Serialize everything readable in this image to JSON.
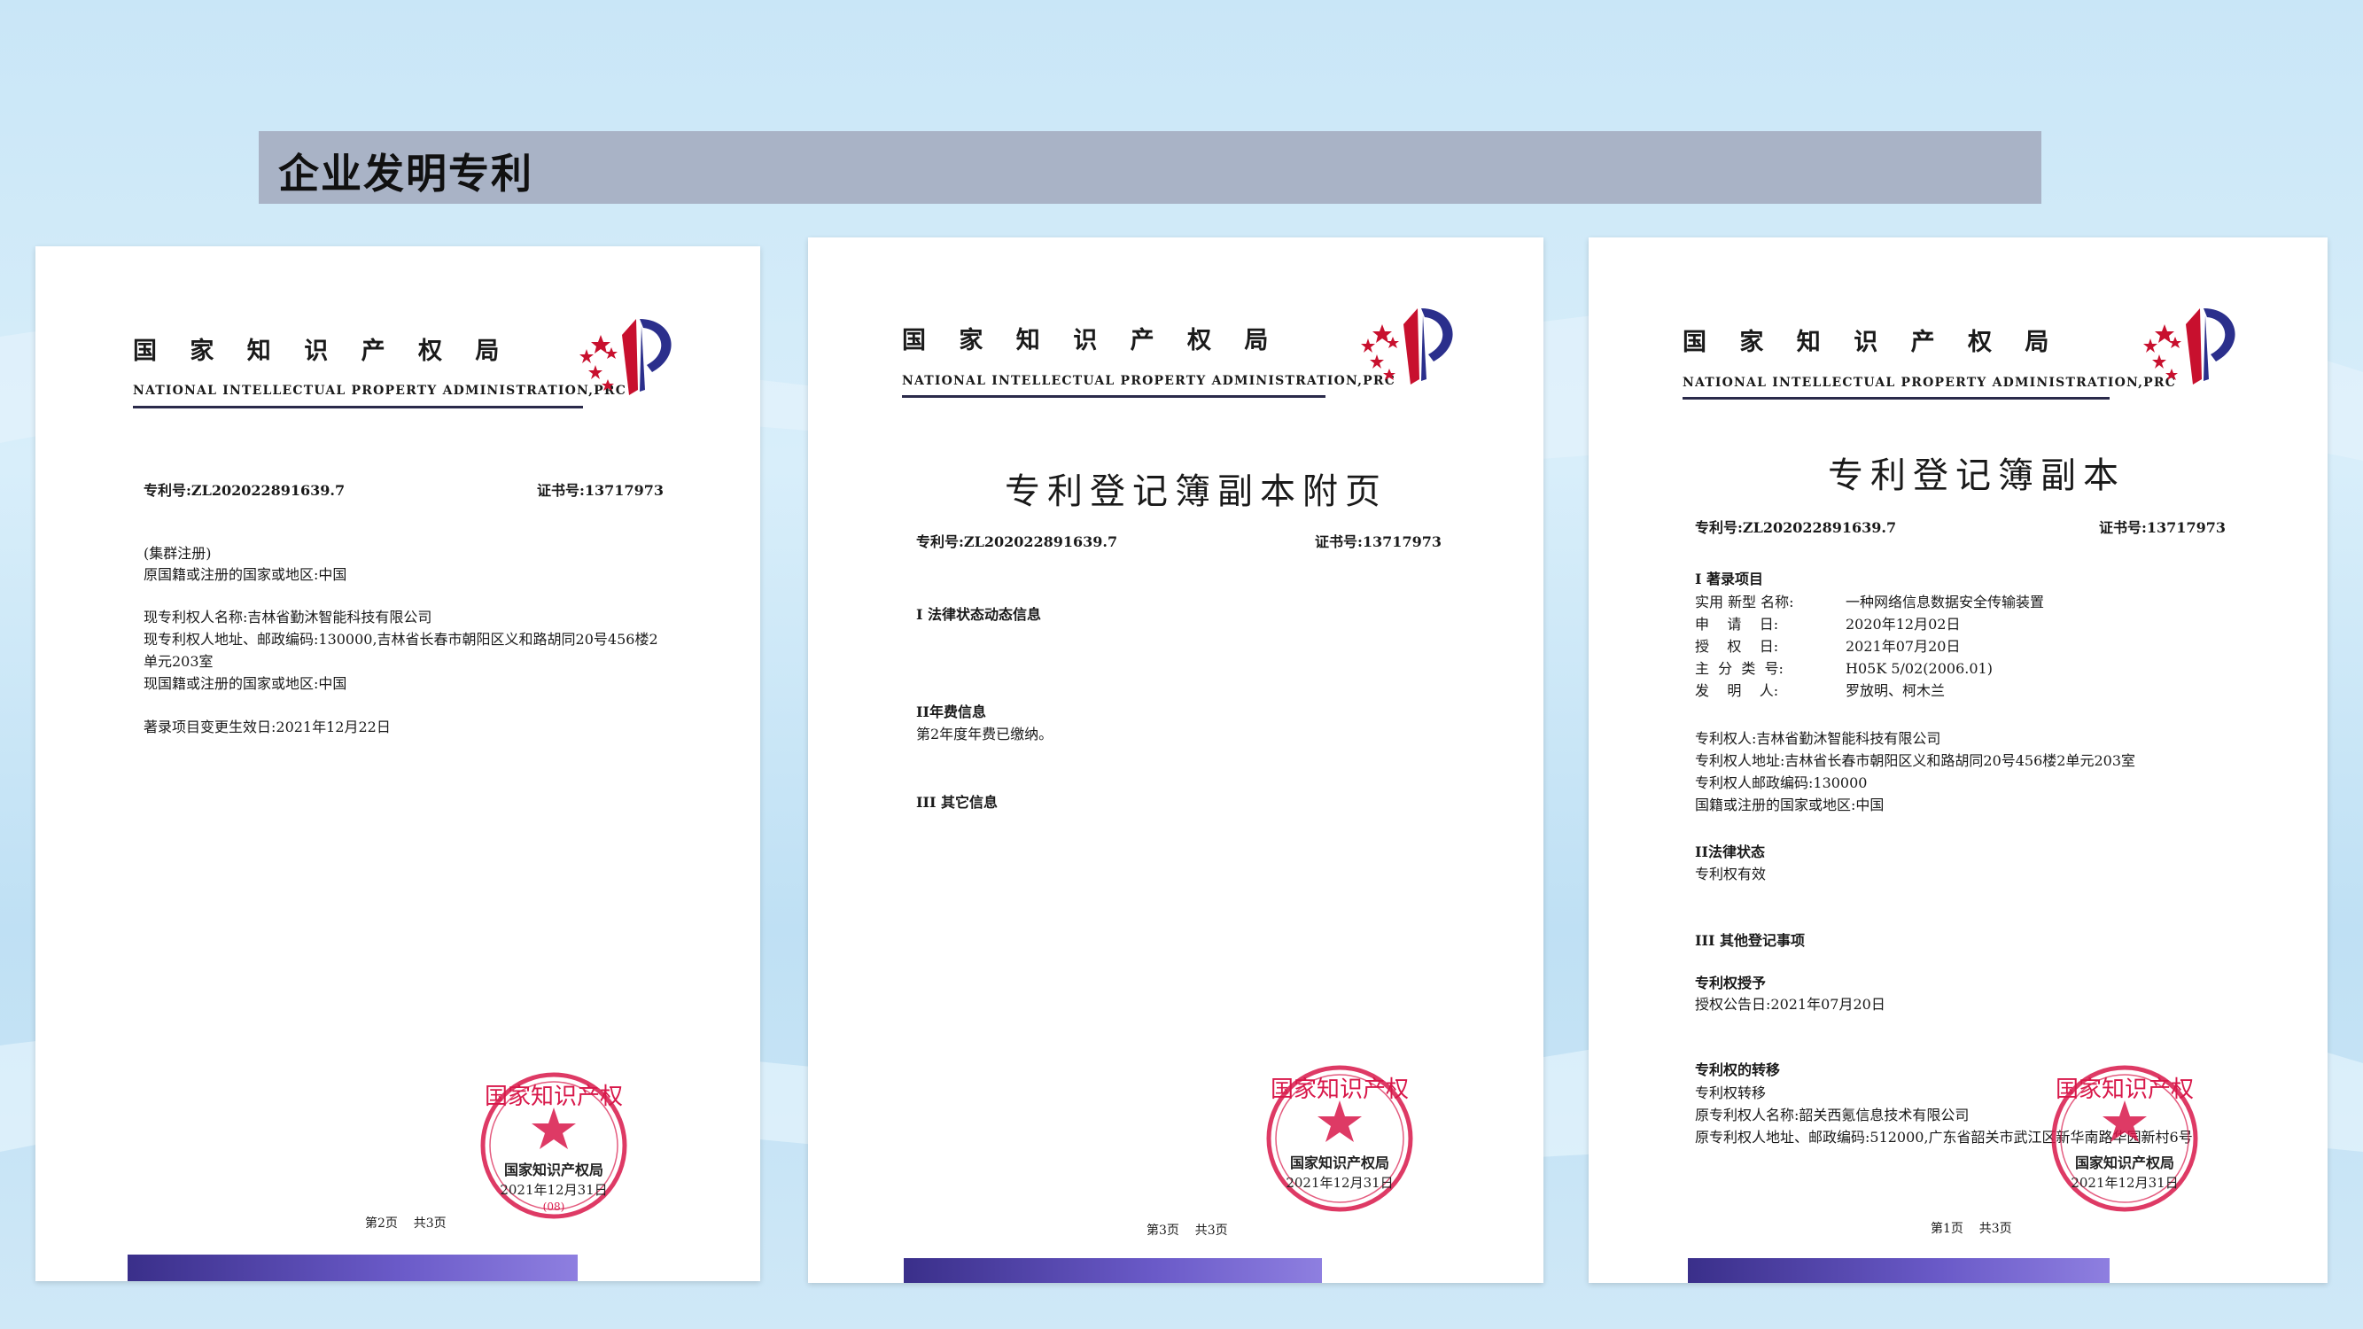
{
  "slide": {
    "title": "企业发明专利"
  },
  "documents": [
    {
      "org_cn": "国 家 知 识 产 权 局",
      "org_en": "NATIONAL INTELLECTUAL PROPERTY ADMINISTRATION,PRC",
      "patent_no": "专利号:ZL202022891639.7",
      "cert_no": "证书号:13717973",
      "lines": [
        "(集群注册)",
        "原国籍或注册的国家或地区:中国",
        "现专利权人名称:吉林省勤沐智能科技有限公司",
        "现专利权人地址、邮政编码:130000,吉林省长春市朝阳区义和路胡同20号456楼2",
        "单元203室",
        "现国籍或注册的国家或地区:中国",
        "著录项目变更生效日:2021年12月22日"
      ],
      "seal_name": "国家知识产权局",
      "seal_date": "2021年12月31日",
      "seal_ring": "国家知识产权",
      "seal_code": "(08)",
      "page": "第2页    共3页"
    },
    {
      "org_cn": "国 家 知 识 产 权 局",
      "org_en": "NATIONAL INTELLECTUAL PROPERTY ADMINISTRATION,PRC",
      "heading": "专利登记簿副本附页",
      "patent_no": "专利号:ZL202022891639.7",
      "cert_no": "证书号:13717973",
      "sections": [
        {
          "title": "I 法律状态动态信息",
          "lines": []
        },
        {
          "title": "II年费信息",
          "lines": [
            "第2年度年费已缴纳。"
          ]
        },
        {
          "title": "III 其它信息",
          "lines": []
        }
      ],
      "seal_name": "国家知识产权局",
      "seal_date": "2021年12月31日",
      "seal_ring": "国家知识产权",
      "page": "第3页    共3页"
    },
    {
      "org_cn": "国 家 知 识 产 权 局",
      "org_en": "NATIONAL INTELLECTUAL PROPERTY ADMINISTRATION,PRC",
      "heading": "专利登记簿副本",
      "patent_no": "专利号:ZL202022891639.7",
      "cert_no": "证书号:13717973",
      "sec1_title": "I 著录项目",
      "fields": [
        {
          "k": "实用 新型 名称:",
          "v": "一种网络信息数据安全传输装置"
        },
        {
          "k": "申    请    日:",
          "v": "2020年12月02日"
        },
        {
          "k": "授    权    日:",
          "v": "2021年07月20日"
        },
        {
          "k": "主  分  类  号:",
          "v": "H05K 5/02(2006.01)"
        },
        {
          "k": "发    明    人:",
          "v": "罗放明、柯木兰"
        }
      ],
      "owner_lines": [
        "专利权人:吉林省勤沐智能科技有限公司",
        "专利权人地址:吉林省长春市朝阳区义和路胡同20号456楼2单元203室",
        "专利权人邮政编码:130000",
        "国籍或注册的国家或地区:中国"
      ],
      "sec2_title": "II法律状态",
      "sec2_line": "专利权有效",
      "sec3_title": "III 其他登记事项",
      "grant_title": "专利权授予",
      "grant_line": "授权公告日:2021年07月20日",
      "transfer_title": "专利权的转移",
      "transfer_lines": [
        "专利权转移",
        "原专利权人名称:韶关西氪信息技术有限公司",
        "原专利权人地址、邮政编码:512000,广东省韶关市武江区新华南路华园新村6号"
      ],
      "seal_name": "国家知识产权局",
      "seal_date": "2021年12月31日",
      "seal_ring": "国家知识产权",
      "page": "第1页    共3页"
    }
  ]
}
